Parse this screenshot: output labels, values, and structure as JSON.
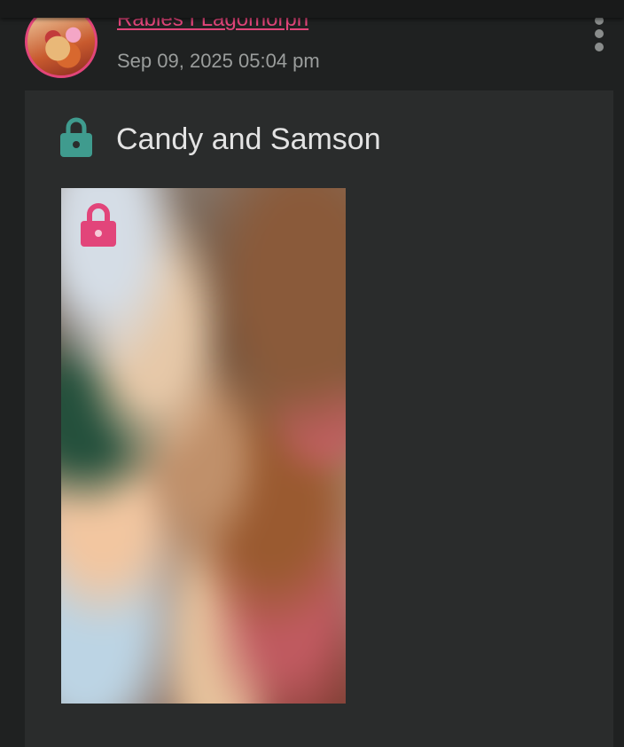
{
  "post": {
    "author": "Rabies I Lagomorph",
    "timestamp": "Sep 09, 2025 05:04 pm",
    "title": "Candy and Samson"
  },
  "icons": {
    "title_lock": "lock-icon",
    "thumbnail_lock": "lock-icon",
    "menu": "more-vertical-icon"
  },
  "colors": {
    "background": "#1f2121",
    "card": "#2a2c2c",
    "accent_pink": "#e2457a",
    "lock_teal": "#3f9b8e",
    "title_text": "#e3e3e3",
    "meta_text": "#9a9d9c"
  }
}
